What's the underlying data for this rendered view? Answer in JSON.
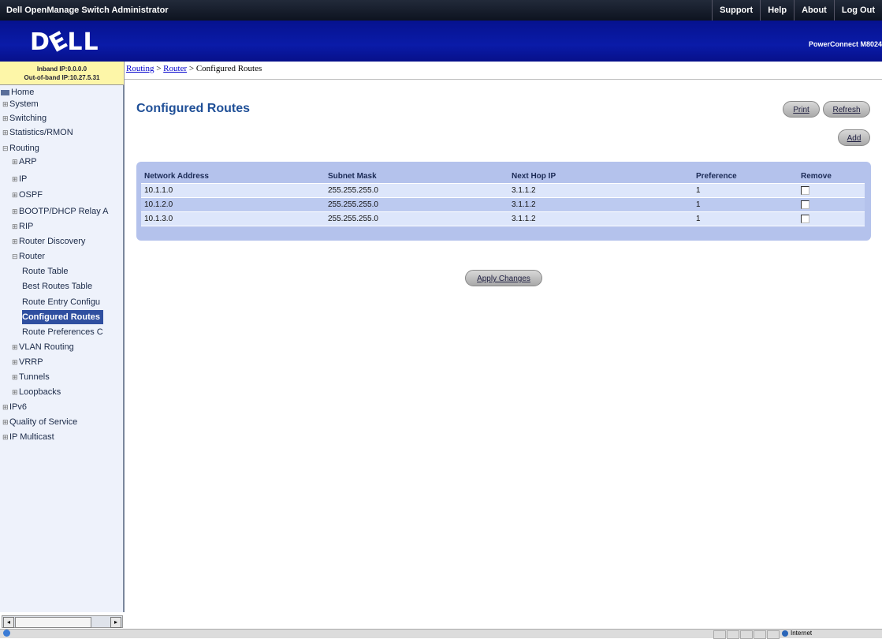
{
  "app_title": "Dell OpenManage Switch Administrator",
  "top_menu": [
    "Support",
    "Help",
    "About",
    "Log Out"
  ],
  "brand": {
    "logo": "DELL",
    "model": "PowerConnect M8024"
  },
  "ip_info": {
    "inband": "Inband IP:0.0.0.0",
    "outband": "Out-of-band IP:10.27.5.31"
  },
  "breadcrumb": {
    "routing": "Routing",
    "sep": " > ",
    "router": "Router",
    "current": "Configured Routes"
  },
  "sidebar": {
    "items": [
      {
        "label": "Home",
        "icon": "home-icon"
      },
      {
        "label": "System",
        "expander": "⊞"
      },
      {
        "label": "Switching",
        "expander": "⊞"
      },
      {
        "label": "Statistics/RMON",
        "expander": "⊞"
      },
      {
        "label": "Routing",
        "expander": "⊟"
      },
      {
        "label": "ARP",
        "expander": "⊞"
      },
      {
        "label": "IP",
        "expander": "⊞"
      },
      {
        "label": "OSPF",
        "expander": "⊞"
      },
      {
        "label": "BOOTP/DHCP Relay A",
        "expander": "⊞"
      },
      {
        "label": "RIP",
        "expander": "⊞"
      },
      {
        "label": "Router Discovery",
        "expander": "⊞"
      },
      {
        "label": "Router",
        "expander": "⊟"
      },
      {
        "label": "Route Table"
      },
      {
        "label": "Best Routes Table"
      },
      {
        "label": "Route Entry Configu"
      },
      {
        "label": "Configured Routes",
        "active": true
      },
      {
        "label": "Route Preferences C"
      },
      {
        "label": "VLAN Routing",
        "expander": "⊞"
      },
      {
        "label": "VRRP",
        "expander": "⊞"
      },
      {
        "label": "Tunnels",
        "expander": "⊞"
      },
      {
        "label": "Loopbacks",
        "expander": "⊞"
      },
      {
        "label": "IPv6",
        "expander": "⊞"
      },
      {
        "label": "Quality of Service",
        "expander": "⊞"
      },
      {
        "label": "IP Multicast",
        "expander": "⊞"
      }
    ]
  },
  "main": {
    "title": "Configured Routes",
    "buttons": {
      "print": "Print",
      "refresh": "Refresh",
      "add": "Add",
      "apply": "Apply Changes"
    },
    "table": {
      "headers": [
        "Network Address",
        "Subnet Mask",
        "Next Hop IP",
        "Preference",
        "Remove"
      ],
      "rows": [
        {
          "network": "10.1.1.0",
          "mask": "255.255.255.0",
          "nexthop": "3.1.1.2",
          "pref": "1"
        },
        {
          "network": "10.1.2.0",
          "mask": "255.255.255.0",
          "nexthop": "3.1.1.2",
          "pref": "1"
        },
        {
          "network": "10.1.3.0",
          "mask": "255.255.255.0",
          "nexthop": "3.1.1.2",
          "pref": "1"
        }
      ]
    }
  },
  "statusbar": {
    "zone": "Internet"
  }
}
